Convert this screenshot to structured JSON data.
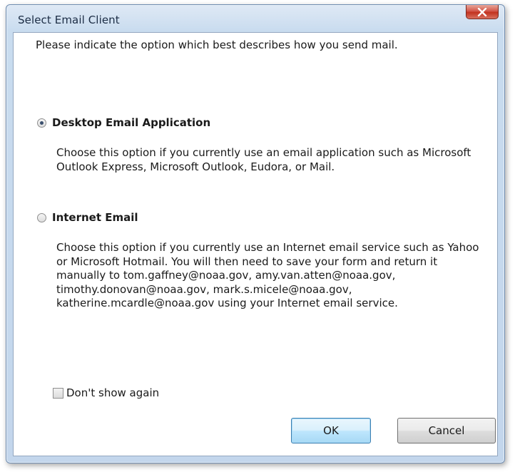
{
  "window": {
    "title": "Select Email Client",
    "close_glyph": "close-icon"
  },
  "prompt": "Please indicate the option which best describes how you send mail.",
  "options": [
    {
      "label": "Desktop Email Application",
      "selected": true,
      "description": "Choose this option if you currently use an email application such as Microsoft Outlook Express, Microsoft Outlook, Eudora, or Mail."
    },
    {
      "label": "Internet Email",
      "selected": false,
      "description": "Choose this option if you currently use an Internet email service such as Yahoo or Microsoft Hotmail. You will then need to save your form and return it manually to tom.gaffney@noaa.gov, amy.van.atten@noaa.gov, timothy.donovan@noaa.gov, mark.s.micele@noaa.gov, katherine.mcardle@noaa.gov using your Internet email service."
    }
  ],
  "dont_show_again": {
    "label": "Don't show again",
    "checked": false
  },
  "buttons": {
    "ok": "OK",
    "cancel": "Cancel"
  },
  "colors": {
    "close_button": "#c2321f",
    "frame": "#c3d6ec"
  }
}
